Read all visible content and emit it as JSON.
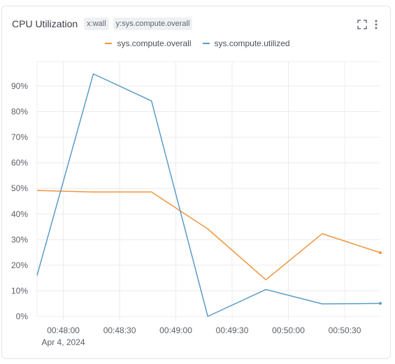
{
  "panel": {
    "title": "CPU Utilization",
    "x_tag": "x:wall",
    "y_tag": "y:sys.compute.overall",
    "icons": [
      "fullscreen-icon",
      "more-vertical-icon"
    ]
  },
  "colors": {
    "overall": "#f0953f",
    "utilized": "#5b9bc8",
    "grid": "#ececec"
  },
  "chart_data": {
    "type": "line",
    "title": "CPU Utilization",
    "xlabel": "",
    "ylabel": "",
    "x_ticks": [
      "00:48:00",
      "00:48:30",
      "00:49:00",
      "00:49:30",
      "00:50:00",
      "00:50:30"
    ],
    "x_date_label": "Apr 4, 2024",
    "x_tick_seconds": [
      2880,
      2910,
      2940,
      2970,
      3000,
      3030
    ],
    "xlim_seconds": [
      2866,
      3049
    ],
    "y_ticks": [
      "0%",
      "10%",
      "20%",
      "30%",
      "40%",
      "50%",
      "60%",
      "70%",
      "80%",
      "90%"
    ],
    "ylim": [
      0,
      100
    ],
    "grid": true,
    "legend_position": "top-center",
    "series": [
      {
        "name": "sys.compute.overall",
        "x_seconds": [
          2866,
          2896,
          2927,
          2957,
          2988,
          3018,
          3049
        ],
        "values": [
          49.2,
          48.6,
          48.6,
          34.2,
          14.3,
          32.3,
          24.9
        ]
      },
      {
        "name": "sys.compute.utilized",
        "x_seconds": [
          2866,
          2896,
          2927,
          2957,
          2988,
          3018,
          3049
        ],
        "values": [
          16.0,
          94.8,
          84.2,
          0.0,
          10.5,
          4.9,
          5.1
        ]
      }
    ]
  }
}
